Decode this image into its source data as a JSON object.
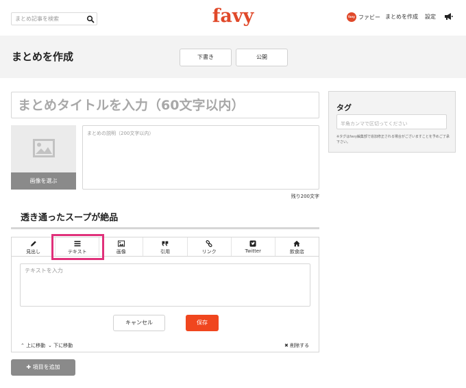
{
  "header": {
    "search_placeholder": "まとめ記事を検索",
    "logo": "favy",
    "user_avatar_text": "favy",
    "username": "ファビー",
    "create_link": "まとめを作成",
    "settings_link": "設定"
  },
  "title_band": {
    "title": "まとめを作成",
    "draft_button": "下書き",
    "publish_button": "公開"
  },
  "form": {
    "title_placeholder": "まとめタイトルを入力（60文字以内）",
    "choose_image": "画像を選ぶ",
    "description_placeholder": "まとめの説明（200文字以内）",
    "chars_remaining": "残り200文字",
    "section_heading": "透き通ったスープが絶品"
  },
  "editor": {
    "tools": [
      {
        "label": "見出し",
        "icon": "pencil-icon"
      },
      {
        "label": "テキスト",
        "icon": "lines-icon"
      },
      {
        "label": "画像",
        "icon": "image-icon"
      },
      {
        "label": "引用",
        "icon": "quote-icon"
      },
      {
        "label": "リンク",
        "icon": "link-icon"
      },
      {
        "label": "Twitter",
        "icon": "twitter-icon"
      },
      {
        "label": "飲食店",
        "icon": "home-icon"
      }
    ],
    "text_placeholder": "テキストを入力",
    "cancel": "キャンセル",
    "save": "保存",
    "move_up": "上に移動",
    "move_down": "下に移動",
    "delete": "削除する"
  },
  "add_item": "項目を追加",
  "tags": {
    "heading": "タグ",
    "placeholder": "半角カンマで区切ってください",
    "note": "※タグはfavy編集部で追加修正される場合がございますことを予めご了承下さい。"
  },
  "colors": {
    "brand": "#e0492a",
    "save_button": "#f0461e",
    "highlight": "#e0307a"
  }
}
